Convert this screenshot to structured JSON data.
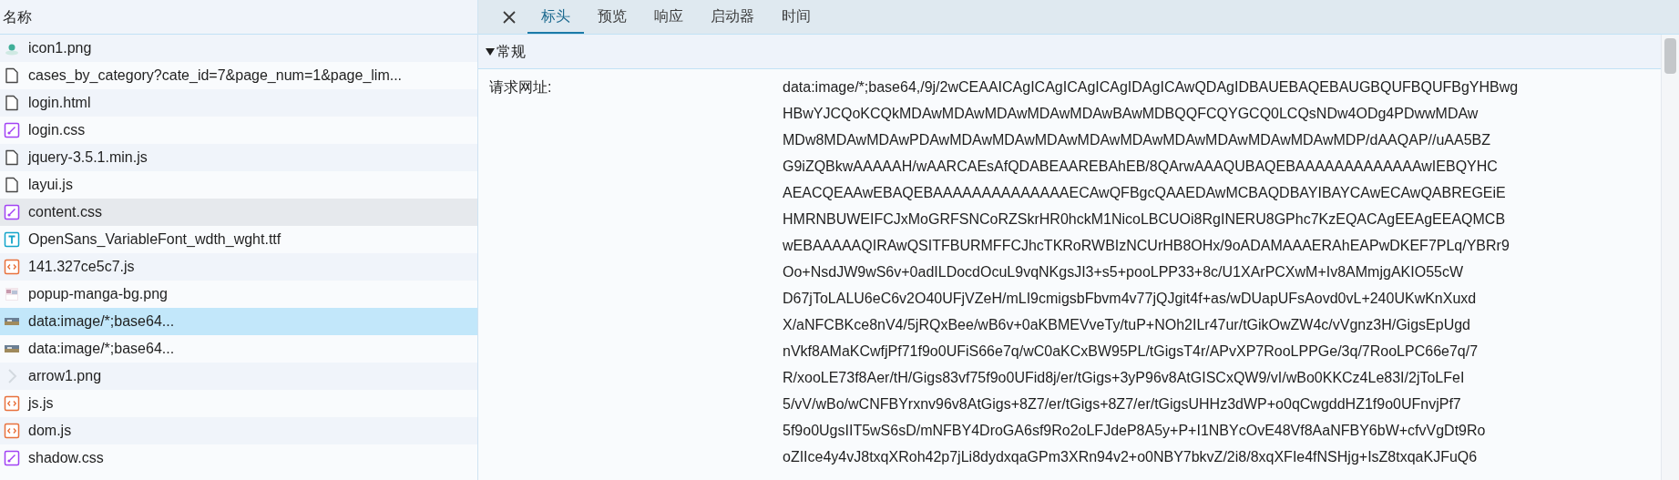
{
  "request_list": {
    "header": "名称",
    "rows": [
      {
        "name": "icon1.png",
        "kind": "image-green",
        "selected": false,
        "hovered": false
      },
      {
        "name": "cases_by_category?cate_id=7&page_num=1&page_lim...",
        "kind": "document",
        "selected": false,
        "hovered": false
      },
      {
        "name": "login.html",
        "kind": "document",
        "selected": false,
        "hovered": false
      },
      {
        "name": "login.css",
        "kind": "stylesheet",
        "selected": false,
        "hovered": false
      },
      {
        "name": "jquery-3.5.1.min.js",
        "kind": "document",
        "selected": false,
        "hovered": false
      },
      {
        "name": "layui.js",
        "kind": "document",
        "selected": false,
        "hovered": false
      },
      {
        "name": "content.css",
        "kind": "stylesheet",
        "selected": false,
        "hovered": true
      },
      {
        "name": "OpenSans_VariableFont_wdth_wght.ttf",
        "kind": "font",
        "selected": false,
        "hovered": false
      },
      {
        "name": "141.327ce5c7.js",
        "kind": "script",
        "selected": false,
        "hovered": false
      },
      {
        "name": "popup-manga-bg.png",
        "kind": "image-pale",
        "selected": false,
        "hovered": false
      },
      {
        "name": "data:image/*;base64...",
        "kind": "image-photo",
        "selected": true,
        "hovered": false
      },
      {
        "name": "data:image/*;base64...",
        "kind": "image-photo",
        "selected": false,
        "hovered": false
      },
      {
        "name": "arrow1.png",
        "kind": "image-arrow",
        "selected": false,
        "hovered": false
      },
      {
        "name": "js.js",
        "kind": "script",
        "selected": false,
        "hovered": false
      },
      {
        "name": "dom.js",
        "kind": "script",
        "selected": false,
        "hovered": false
      },
      {
        "name": "shadow.css",
        "kind": "stylesheet",
        "selected": false,
        "hovered": false
      }
    ]
  },
  "detail": {
    "tabs": [
      {
        "label": "标头",
        "selected": true
      },
      {
        "label": "预览",
        "selected": false
      },
      {
        "label": "响应",
        "selected": false
      },
      {
        "label": "启动器",
        "selected": false
      },
      {
        "label": "时间",
        "selected": false
      }
    ],
    "section": {
      "title": "常规",
      "expanded": true,
      "fields": [
        {
          "label": "请求网址:",
          "value_lines": [
            "data:image/*;base64,/9j/2wCEAAICAgICAgICAgICAgIDAgICAwQDAgIDBAUEBAQEBAUGBQUFBQUFBgYHBwg",
            "HBwYJCQoKCQkMDAwMDAwMDAwMDAwMDAwBAwMDBQQFCQYGCQ0LCQsNDw4ODg4PDwwMDAw",
            "MDw8MDAwMDAwPDAwMDAwMDAwMDAwMDAwMDAwMDAwMDAwMDAwMDAwMDP/dAAQAP//uAA5BZ",
            "G9iZQBkwAAAAAH/wAARCAEsAfQDABEAAREBAhEB/8QArwAAAQUBAQEBAAAAAAAAAAAAAwIEBQYHC",
            "AEACQEAAwEBAQEBAAAAAAAAAAAAAAECAwQFBgcQAAEDAwMCBAQDBAYIBAYCAwECAwQABREGEiE",
            "HMRNBUWEIFCJxMoGRFSNCoRZSkrHR0hckM1NicoLBCUOi8RgINERU8GPhc7KzEQACAgEEAgEEAQMCB",
            "wEBAAAAAQIRAwQSITFBURMFFCJhcTKRoRWBIzNCUrHB8OHx/9oADAMAAAERAhEAPwDKEF7PLq/YBRr9",
            "Oo+NsdJW9wS6v+0adILDocdOcuL9vqNKgsJI3+s5+pooLPP33+8c/U1XArPCXwM+Iv8AMmjgAKIO55cW",
            "D67jToLALU6eC6v2O40UFjVZeH/mLI9cmigsbFbvm4v77jQJgit4f+as/wDUapUFsAovd0vL+240UKwKnXuxd",
            "X/aNFCBKce8nV4/5jRQxBee/wB6v+0aKBMEVveTy/tuP+NOh2ILr47ur/tGikOwZW4c/vVgnz3H/GigsEpUgd",
            "nVkf8AMaKCwfjPf71f9o0UFiS66e7q/wC0aKCxBW95PL/tGigsT4r/APvXP7RooLPPGe/3q/7RooLPC66e7q/7",
            "R/xooLE73f8Aer/tH/Gigs83vf75f9o0UFid8j/er/tGigs+3yP96v8AtGISCxQW9/vI/wBo0KKCz4Le83I/2jToLFeI",
            "5/vV/wBo/wCNFBYrxnv96v8AtGigs+8Z7/er/tGigs+8Z7/er/tGigsUHHz3dWP+o0qCwgddHZ1f9o0UFnvjPf7",
            "5f9o0UgsIIT5wS6sD/mNFBY4DroGA6sf9Ro2oLFJdeP8A5y+P+I1NBYcOvE48Vf8AaNFBY6bW+cfvVgDt9Ro",
            "oZIIce4y4vJ8txqXRoh42p7jLi8dydxqaGPm3XRn94v2+o0NBY7bkvZ/2i8/8xqXFIe4fNSHjg+IsZ8txqaKJFuQ6"
          ]
        }
      ]
    }
  },
  "scrollbar": {
    "level": 0.08
  }
}
